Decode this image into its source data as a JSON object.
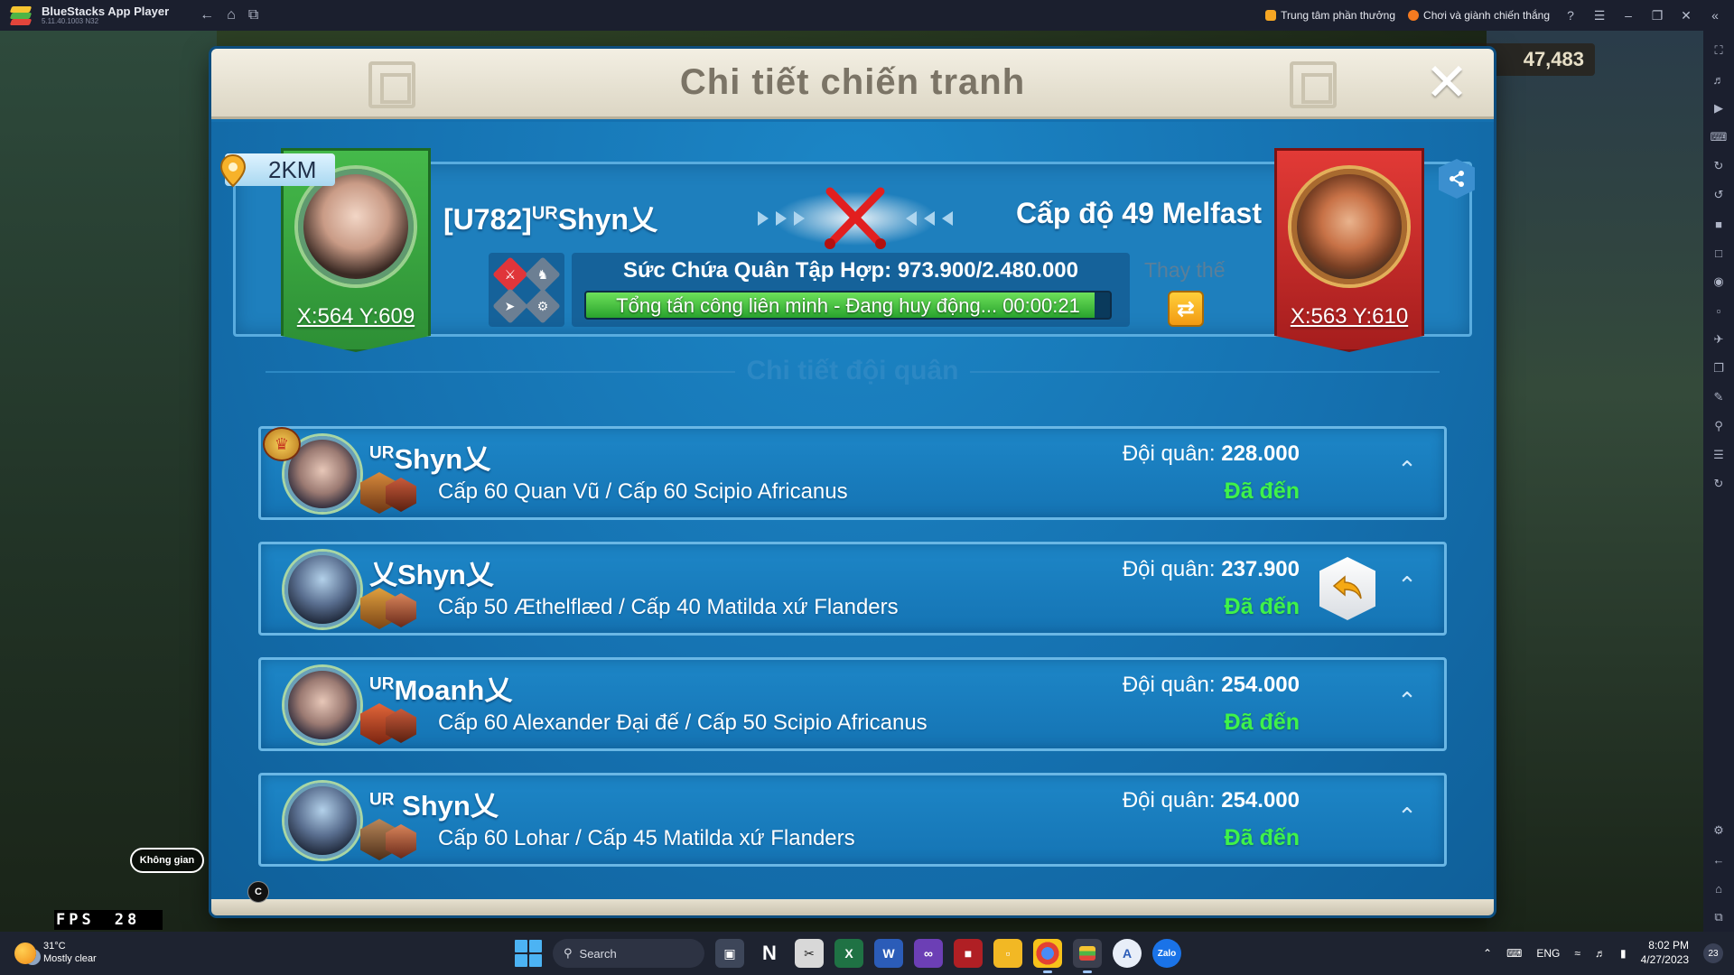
{
  "app": {
    "title": "BlueStacks App Player",
    "version": "5.11.40.1003 N32",
    "rewards_label": "Trung tâm phần thưởng",
    "play_win_label": "Chơi và giành chiến thắng"
  },
  "game": {
    "space_button": "Không gian",
    "fps_label": "FPS",
    "fps_value": "28",
    "resource_value": "47,483"
  },
  "dialog": {
    "title": "Chi tiết chiến tranh",
    "footer_button": "C",
    "attacker": {
      "distance": "2KM",
      "name_prefix": "[U782]",
      "name_sup": "UR",
      "name": "Shyn乂",
      "coords": "X:564 Y:609"
    },
    "defender": {
      "name": "Cấp độ 49 Melfast",
      "coords": "X:563 Y:610"
    },
    "capacity_text": "Sức Chứa Quân Tập Hợp: 973.900/2.480.000",
    "progress_text": "Tổng tấn công liên minh - Đang huy động... 00:00:21",
    "progress_fraction": 0.97,
    "replace_label": "Thay thế",
    "section_title": "Chi tiết đội quân"
  },
  "troops": [
    {
      "sup": "UR",
      "name": "Shyn乂",
      "heroes": "Cấp 60 Quan Vũ / Cấp 60 Scipio Africanus",
      "count_label": "Đội quân:",
      "count": "228.000",
      "status": "Đã đến"
    },
    {
      "sup": "",
      "name": "乂Shyn乂",
      "heroes": "Cấp 50 Æthelflæd / Cấp 40 Matilda xứ Flanders",
      "count_label": "Đội quân:",
      "count": "237.900",
      "status": "Đã đến"
    },
    {
      "sup": "UR",
      "name": "Moanh乂",
      "heroes": "Cấp 60 Alexander Đại đế / Cấp 50 Scipio Africanus",
      "count_label": "Đội quân:",
      "count": "254.000",
      "status": "Đã đến"
    },
    {
      "sup": "UR",
      "name": " Shyn乂",
      "heroes": "Cấp 60 Lohar / Cấp 45 Matilda xứ Flanders",
      "count_label": "Đội quân:",
      "count": "254.000",
      "status": "Đã đến"
    }
  ],
  "taskbar": {
    "weather_temp": "31°C",
    "weather_desc": "Mostly clear",
    "search_label": "Search",
    "language": "ENG",
    "time": "8:02 PM",
    "date": "4/27/2023",
    "notification_count": "23"
  },
  "colors": {
    "dialog_blue": "#1571b0",
    "arrived_green": "#3ff24a",
    "attacker_banner": "#45b94a",
    "defender_banner": "#e23a36"
  }
}
